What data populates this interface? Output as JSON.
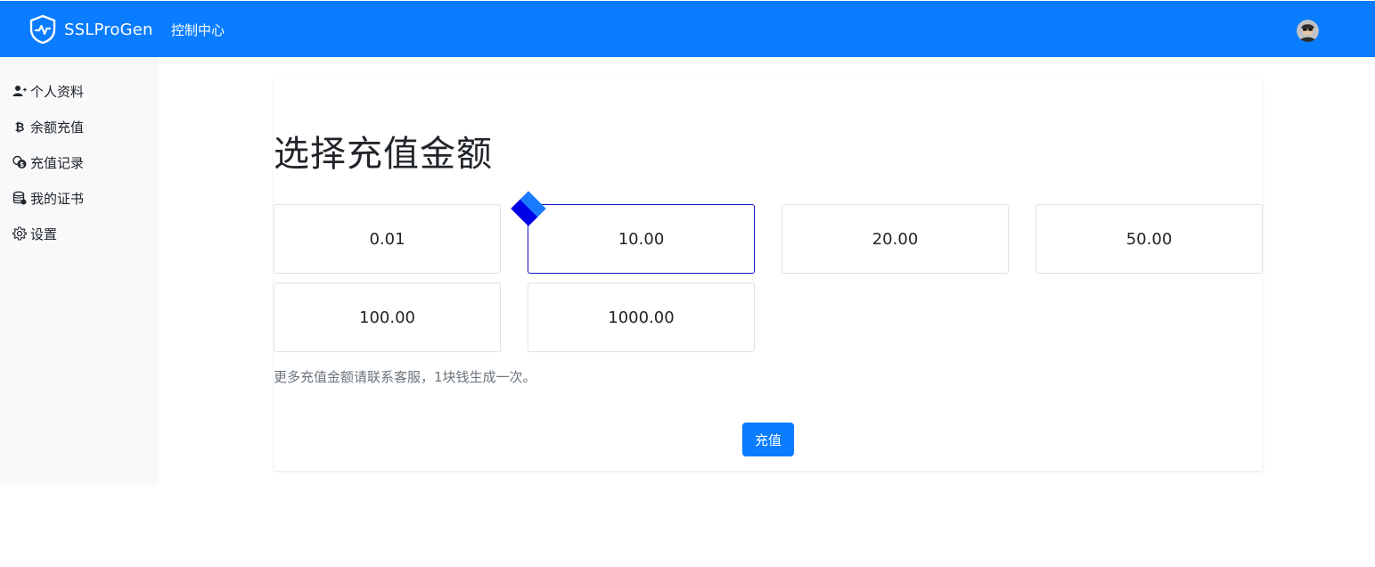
{
  "header": {
    "brand": "SSLProGen",
    "nav_link": "控制中心",
    "accent_color": "#0a7cff"
  },
  "sidebar": {
    "items": [
      {
        "label": "个人资料",
        "icon": "user-plus-icon"
      },
      {
        "label": "余额充值",
        "icon": "bitcoin-icon"
      },
      {
        "label": "充值记录",
        "icon": "coins-icon"
      },
      {
        "label": "我的证书",
        "icon": "database-icon"
      },
      {
        "label": "设置",
        "icon": "gear-icon"
      }
    ]
  },
  "main": {
    "title": "选择充值金额",
    "amounts": [
      "0.01",
      "10.00",
      "20.00",
      "50.00",
      "100.00",
      "1000.00"
    ],
    "selected_amount": "10.00",
    "hint": "更多充值金额请联系客服，1块钱生成一次。",
    "submit_label": "充值"
  }
}
